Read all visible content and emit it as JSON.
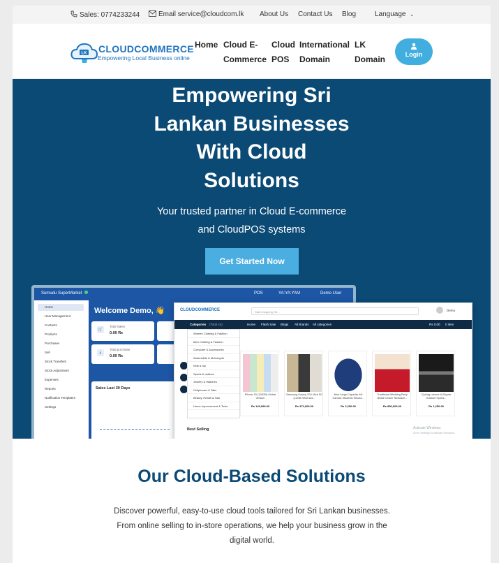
{
  "topbar": {
    "sales": "Sales: 0774233244",
    "email": "Email service@cloudcom.lk",
    "about": "About Us",
    "contact": "Contact Us",
    "blog": "Blog",
    "language": "Language"
  },
  "nav": {
    "logo_brand": "CLOUDCOMMERCE",
    "logo_tagline": "Empowering Local Business online",
    "logo_badge": "LK",
    "items": [
      {
        "line1": "Home",
        "line2": ""
      },
      {
        "line1": "Cloud E-",
        "line2": "Commerce"
      },
      {
        "line1": "Cloud",
        "line2": "POS"
      },
      {
        "line1": "International",
        "line2": "Domain"
      },
      {
        "line1": "LK",
        "line2": "Domain"
      }
    ],
    "login": "Login"
  },
  "hero": {
    "title_lines": [
      "Empowering Sri",
      "Lankan Businesses",
      "With Cloud",
      "Solutions"
    ],
    "subtitle_lines": [
      "Your trusted partner in Cloud E-commerce",
      "and CloudPOS systems"
    ],
    "cta": "Get Started Now"
  },
  "dashboard": {
    "store_name": "Sumudu SuperMarket",
    "topbar_pos": "POS",
    "topbar_time": "YA:YA:YAM",
    "topbar_user": "Demo User",
    "welcome": "Welcome Demo, 👋",
    "cards": [
      {
        "label": "Total Sales",
        "value": "0.00 ₨"
      },
      {
        "label": "Total purchase",
        "value": "0.00 ₨"
      }
    ],
    "sales_title": "Sales Last 30 Days",
    "menu": [
      "Home",
      "User Management",
      "Contacts",
      "Products",
      "Purchases",
      "Sell",
      "Stock Transfers",
      "Stock Adjustment",
      "Expenses",
      "Reports",
      "Notification Templates",
      "Settings"
    ]
  },
  "store": {
    "search_placeholder": "Start shopping, fin...",
    "user": "Demo",
    "cart": "Rs 0.00",
    "cart_items": "0 item",
    "categories_label": "Categories",
    "categories_count": "(Total 44)",
    "nav": [
      "Home",
      "Flash Sale",
      "Blogs",
      "All Brands",
      "All categories"
    ],
    "categories": [
      "Women Clothing & Fashion",
      "Men Clothing & Fashion",
      "Computer & Accessories",
      "Automobile & Motorcycle",
      "Kids & toy",
      "Sports & outdoor",
      "Jewelry & Watches",
      "Cellphones & Tabs",
      "Beauty, Health & Hair",
      "Home Improvement & Tools"
    ],
    "products": [
      {
        "name": "iPhone 15 (128GB) Global Version",
        "price": "Rs 143,999.00"
      },
      {
        "name": "Samsung Galaxy S24 Ultra 5G (12GB RAM and...",
        "price": "Rs 372,000.00"
      },
      {
        "name": "New Large-Capacity 4/6 Canvas Students Should...",
        "price": "Rs 2,250.00"
      },
      {
        "name": "Traditional Wedding Party Bridal Choker Necklace...",
        "price": "Rs 850,000.00"
      },
      {
        "name": "Cycling Leisure & Bicycle Outdoor Sports...",
        "price": "Rs 1,250.00"
      }
    ],
    "best_selling": "Best Selling",
    "watermark_title": "Activate Windows",
    "watermark_sub": "Go to Settings to activate Windows."
  },
  "solutions": {
    "title": "Our Cloud-Based Solutions",
    "body_lines": [
      "Discover powerful, easy-to-use cloud tools tailored for Sri Lankan businesses.",
      "From online selling to in-store operations, we help your business grow in the",
      "digital world."
    ]
  },
  "colors": {
    "hero_bg": "#0b4a75",
    "accent": "#41aedf",
    "heading": "#0b4a75"
  }
}
